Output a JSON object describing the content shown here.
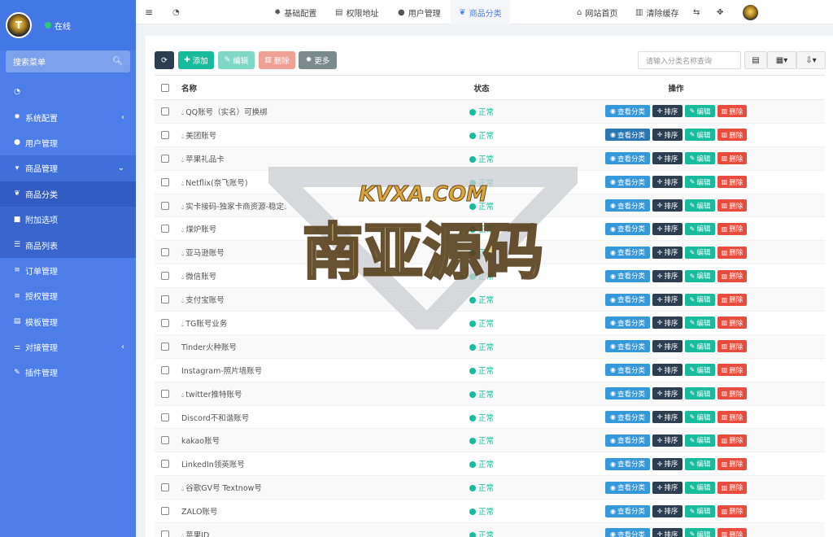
{
  "sidebar": {
    "status": "在线",
    "search_label": "搜索菜单",
    "items": [
      {
        "label": "",
        "icon": "dashboard-icon"
      },
      {
        "label": "系统配置",
        "icon": "gear-icon",
        "arrow": "‹"
      },
      {
        "label": "用户管理",
        "icon": "user-icon"
      },
      {
        "label": "商品管理",
        "icon": "cart-icon",
        "arrow": "⌄"
      },
      {
        "label": "商品分类",
        "icon": "leaf-icon"
      },
      {
        "label": "附加选项",
        "icon": "bookmark-icon"
      },
      {
        "label": "商品列表",
        "icon": "list-icon"
      },
      {
        "label": "订单管理",
        "icon": "bars-icon"
      },
      {
        "label": "授权管理",
        "icon": "bars-icon"
      },
      {
        "label": "模板管理",
        "icon": "template-icon"
      },
      {
        "label": "对接管理",
        "icon": "sliders-icon",
        "arrow": "‹"
      },
      {
        "label": "插件管理",
        "icon": "plug-icon"
      }
    ]
  },
  "topbar": {
    "tabs": [
      "基础配置",
      "权限地址",
      "用户管理",
      "商品分类"
    ],
    "right": [
      "网站首页",
      "清除缓存"
    ]
  },
  "toolbar": {
    "add": "添加",
    "edit": "编辑",
    "delete": "删除",
    "more": "更多",
    "search_placeholder": "请输入分类名称查询"
  },
  "table": {
    "headers": {
      "name": "名称",
      "status": "状态",
      "action": "操作"
    },
    "status_label": "正常",
    "actions": {
      "view": "查看分类",
      "sort": "排序",
      "edit": "编辑",
      "delete": "删除"
    },
    "rows": [
      {
        "name": "QQ账号（实名）可换绑",
        "drop": true
      },
      {
        "name": "美团账号",
        "drop": true
      },
      {
        "name": "苹果礼品卡",
        "drop": true
      },
      {
        "name": "Netflix(奈飞账号)",
        "drop": true
      },
      {
        "name": "实卡接码-独家卡商资源-稳定",
        "drop": true,
        "drop_end": true
      },
      {
        "name": "煤炉账号",
        "drop": true
      },
      {
        "name": "亚马逊账号",
        "drop": true
      },
      {
        "name": "微信账号",
        "drop": true
      },
      {
        "name": "支付宝账号",
        "drop": true
      },
      {
        "name": "TG账号业务",
        "drop": true
      },
      {
        "name": "Tinder火种账号",
        "drop": false
      },
      {
        "name": "Instagram-照片墙账号",
        "drop": false
      },
      {
        "name": "twitter推特账号",
        "drop": true
      },
      {
        "name": "Discord不和谐账号",
        "drop": false
      },
      {
        "name": "kakao账号",
        "drop": false
      },
      {
        "name": "LinkedIn领英账号",
        "drop": false
      },
      {
        "name": "谷歌GV号 Textnow号",
        "drop": true
      },
      {
        "name": "ZALO账号",
        "drop": false
      },
      {
        "name": "苹果ID",
        "drop": true
      }
    ]
  },
  "watermark": {
    "site": "KVXA.COM",
    "title": "南亚源码"
  },
  "colors": {
    "sidebar": "#4d7de8",
    "add": "#18bc9c",
    "view": "#3498db",
    "sort": "#2c3e50",
    "delete": "#e74c3c"
  }
}
